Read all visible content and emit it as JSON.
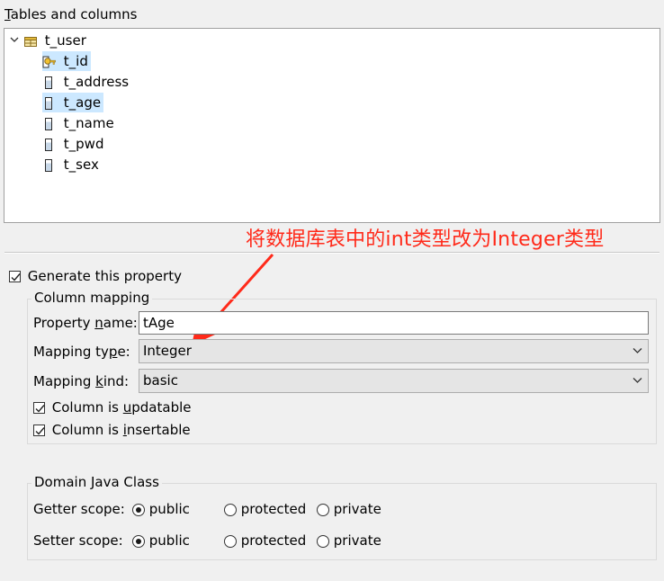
{
  "section": {
    "title_pre": "",
    "title_u": "T",
    "title_post": "ables and columns"
  },
  "tree": {
    "table": {
      "name": "t_user",
      "icon": "table-icon"
    },
    "columns": [
      {
        "name": "t_id",
        "icon": "key-icon",
        "selected": true
      },
      {
        "name": "t_address",
        "icon": "column-icon",
        "selected": false
      },
      {
        "name": "t_age",
        "icon": "column-icon",
        "selected": true
      },
      {
        "name": "t_name",
        "icon": "column-icon",
        "selected": false
      },
      {
        "name": "t_pwd",
        "icon": "column-icon",
        "selected": false
      },
      {
        "name": "t_sex",
        "icon": "column-icon",
        "selected": false
      }
    ]
  },
  "annotation": {
    "text": "将数据库表中的int类型改为Integer类型",
    "color": "#ff2a1a"
  },
  "generate": {
    "label": "Generate this property",
    "checked": true
  },
  "column_mapping": {
    "title": "Column mapping",
    "property_name": {
      "label_pre": "Property ",
      "label_u": "n",
      "label_post": "ame:",
      "value": "tAge"
    },
    "mapping_type": {
      "label_pre": "Mapping ty",
      "label_u": "p",
      "label_post": "e:",
      "value": "Integer"
    },
    "mapping_kind": {
      "label_pre": "Mapping ",
      "label_u": "k",
      "label_post": "ind:",
      "value": "basic"
    },
    "updatable": {
      "label_pre": "Column is ",
      "label_u": "u",
      "label_post": "pdatable",
      "checked": true
    },
    "insertable": {
      "label_pre": "Column is ",
      "label_u": "i",
      "label_post": "nsertable",
      "checked": true
    }
  },
  "domain": {
    "title": "Domain Java Class",
    "getter": {
      "label": "Getter scope:",
      "options": [
        "public",
        "protected",
        "private"
      ],
      "selected": "public"
    },
    "setter": {
      "label": "Setter scope:",
      "options": [
        "public",
        "protected",
        "private"
      ],
      "selected": "public"
    }
  }
}
